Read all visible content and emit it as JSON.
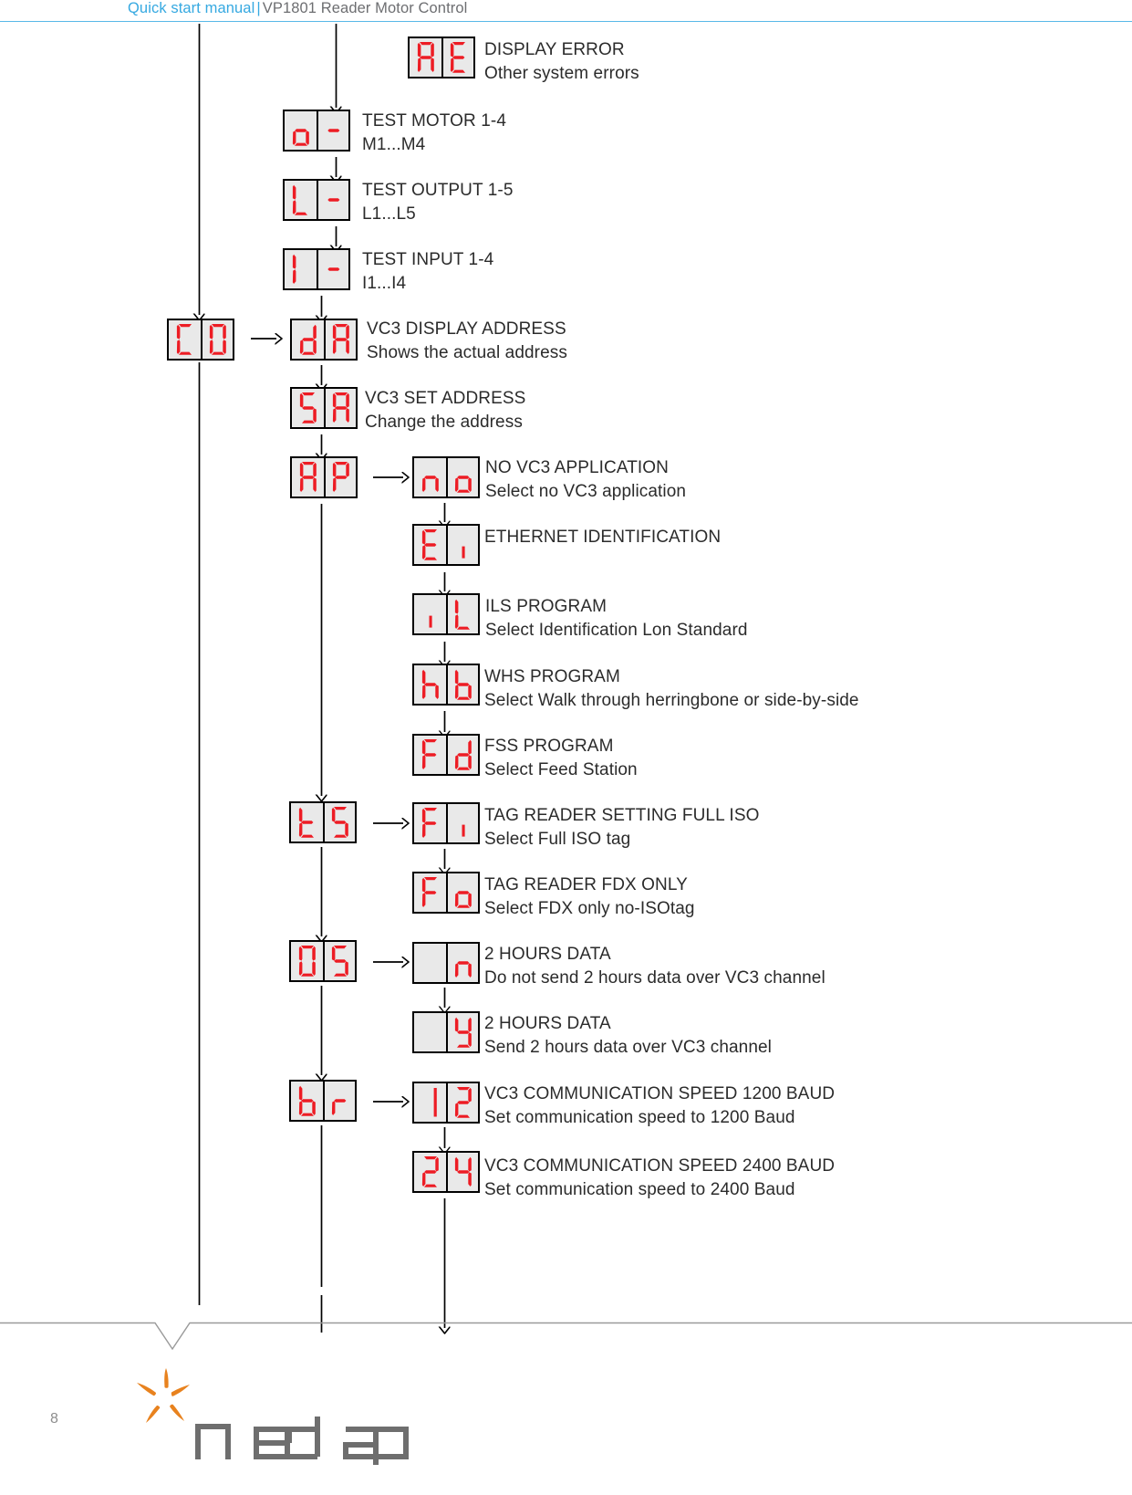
{
  "header": {
    "title_blue": "Quick start manual",
    "separator": "|",
    "title_grey": "VP1801 Reader Motor Control"
  },
  "footer": {
    "page_number": "8",
    "logo_text": "nedap"
  },
  "colors": {
    "header_blue": "#36a9e1",
    "header_grey": "#6d6e71",
    "segment_red": "#ed1c24",
    "display_bg": "#e9e9e9",
    "display_border": "#000000",
    "logo_grey": "#6e6e6e",
    "logo_orange": "#e8821e",
    "line_black": "#000000",
    "rule_grey": "#9a9a9a"
  },
  "nodes": [
    {
      "id": "ae",
      "code": "AE",
      "digits": [
        "A",
        "E"
      ],
      "title": "DISPLAY ERROR",
      "subtitle": "Other system errors"
    },
    {
      "id": "o-",
      "code": "o-",
      "digits": [
        "o",
        "-"
      ],
      "title": "TEST MOTOR 1-4",
      "subtitle": "M1...M4"
    },
    {
      "id": "l-",
      "code": "L-",
      "digits": [
        "L",
        "-"
      ],
      "title": "TEST OUTPUT 1-5",
      "subtitle": "L1...L5"
    },
    {
      "id": "i-",
      "code": "I-",
      "digits": [
        "I",
        "-"
      ],
      "title": "TEST INPUT 1-4",
      "subtitle": "I1...I4"
    },
    {
      "id": "co",
      "code": "C0",
      "digits": [
        "C",
        "0"
      ],
      "title": "",
      "subtitle": ""
    },
    {
      "id": "da",
      "code": "dA",
      "digits": [
        "d",
        "A"
      ],
      "title": "VC3 DISPLAY ADDRESS",
      "subtitle": "Shows the actual address"
    },
    {
      "id": "sa",
      "code": "SA",
      "digits": [
        "S",
        "A"
      ],
      "title": "VC3 SET ADDRESS",
      "subtitle": "Change the address"
    },
    {
      "id": "ap",
      "code": "AP",
      "digits": [
        "A",
        "P"
      ],
      "title": "",
      "subtitle": ""
    },
    {
      "id": "no",
      "code": "no",
      "digits": [
        "n",
        "o"
      ],
      "title": "NO VC3 APPLICATION",
      "subtitle": "Select no VC3 application"
    },
    {
      "id": "ei",
      "code": "Ei",
      "digits": [
        "E",
        "i"
      ],
      "title": "ETHERNET IDENTIFICATION",
      "subtitle": ""
    },
    {
      "id": "il",
      "code": "iL",
      "digits": [
        "i",
        "L"
      ],
      "title": "ILS PROGRAM",
      "subtitle": "Select Identification Lon Standard"
    },
    {
      "id": "hb",
      "code": "hb",
      "digits": [
        "h",
        "b"
      ],
      "title": "WHS PROGRAM",
      "subtitle": "Select Walk through herringbone or side-by-side"
    },
    {
      "id": "fd",
      "code": "Fd",
      "digits": [
        "F",
        "d"
      ],
      "title": "FSS PROGRAM",
      "subtitle": "Select Feed Station"
    },
    {
      "id": "ts",
      "code": "tS",
      "digits": [
        "t",
        "S"
      ],
      "title": "",
      "subtitle": ""
    },
    {
      "id": "fi",
      "code": "Fi",
      "digits": [
        "F",
        "i"
      ],
      "title": "TAG READER SETTING FULL ISO",
      "subtitle": "Select Full ISO tag"
    },
    {
      "id": "fo",
      "code": "Fo",
      "digits": [
        "F",
        "o"
      ],
      "title": "TAG READER FDX ONLY",
      "subtitle": "Select FDX only no-ISOtag"
    },
    {
      "id": "os",
      "code": "0S",
      "digits": [
        "0",
        "S"
      ],
      "title": "",
      "subtitle": ""
    },
    {
      "id": "blank-n",
      "code": "n",
      "digits": [
        " ",
        "n"
      ],
      "title": "2 HOURS DATA",
      "subtitle": "Do not send 2 hours data over VC3 channel"
    },
    {
      "id": "blank-y",
      "code": "y",
      "digits": [
        " ",
        "y"
      ],
      "title": "2 HOURS DATA",
      "subtitle": "Send 2 hours data over VC3 channel"
    },
    {
      "id": "br",
      "code": "br",
      "digits": [
        "b",
        "r"
      ],
      "title": "",
      "subtitle": ""
    },
    {
      "id": "12",
      "code": "12",
      "digits": [
        "1",
        "2"
      ],
      "title": "VC3 COMMUNICATION SPEED 1200 BAUD",
      "subtitle": "Set communication speed to 1200 Baud"
    },
    {
      "id": "24",
      "code": "24",
      "digits": [
        "2",
        "4"
      ],
      "title": "VC3 COMMUNICATION SPEED 2400 BAUD",
      "subtitle": "Set communication speed to 2400 Baud"
    }
  ]
}
